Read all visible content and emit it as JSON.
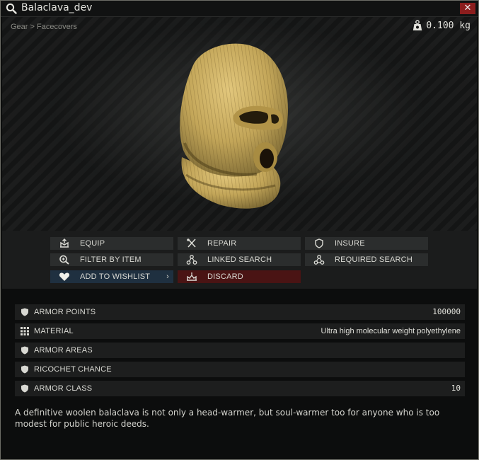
{
  "window": {
    "title": "Balaclava_dev",
    "close_label": "✕",
    "icons": {
      "title": "magnifier-icon",
      "close": "close-icon"
    }
  },
  "preview": {
    "breadcrumb": "Gear > Facecovers",
    "weight": "0.100 kg",
    "weight_icon": "weight-icon",
    "item_image": "balaclava-image"
  },
  "actions": [
    {
      "label": "EQUIP",
      "icon": "equip-icon"
    },
    {
      "label": "REPAIR",
      "icon": "repair-icon"
    },
    {
      "label": "INSURE",
      "icon": "shield-icon"
    },
    {
      "label": "FILTER BY ITEM",
      "icon": "filter-search-icon"
    },
    {
      "label": "LINKED SEARCH",
      "icon": "linked-search-icon"
    },
    {
      "label": "REQUIRED SEARCH",
      "icon": "required-search-icon"
    },
    {
      "label": "ADD TO WISHLIST",
      "icon": "heart-icon",
      "chevron": "›"
    },
    {
      "label": "DISCARD",
      "icon": "discard-icon"
    }
  ],
  "stats": [
    {
      "label": "ARMOR POINTS",
      "value": "100000",
      "icon": "shield-icon"
    },
    {
      "label": "MATERIAL",
      "value": "Ultra high molecular weight polyethylene",
      "icon": "grid-icon"
    },
    {
      "label": "ARMOR AREAS",
      "value": "",
      "icon": "shield-icon"
    },
    {
      "label": "RICOCHET CHANCE",
      "value": "",
      "icon": "shield-icon"
    },
    {
      "label": "ARMOR CLASS",
      "value": "10",
      "icon": "shield-icon"
    }
  ],
  "description": "A definitive woolen balaclava is not only a head-warmer, but soul-warmer too for anyone who is too modest for public heroic deeds.",
  "colors": {
    "wishlist_bg": "#1f3040",
    "discard_bg": "#4a1414",
    "close_bg": "#8b1d1d",
    "button_bg": "#2b2d2d",
    "balaclava": "#c8aa5e"
  }
}
